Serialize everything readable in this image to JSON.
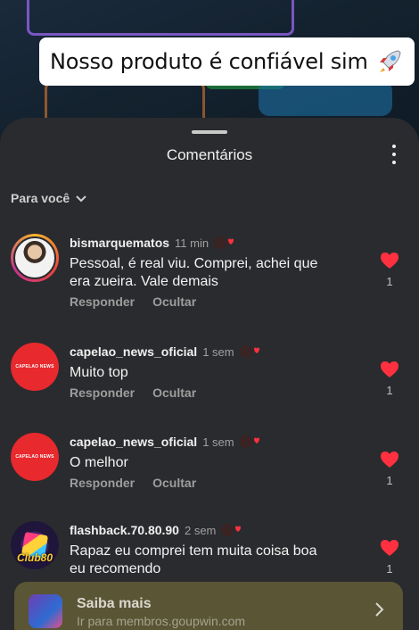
{
  "video": {
    "caption": "Nosso produto é confiável sim",
    "caption_emoji": "rocket-icon"
  },
  "sheet": {
    "title": "Comentários",
    "filter_label": "Para você",
    "menu_icon": "more-vertical-icon"
  },
  "comments": [
    {
      "user": "bismarquematos",
      "time": "11 min",
      "text_line1": "Pessoal, é real viu. Comprei, achei que",
      "text_line2": "era zueira. Vale demais",
      "reply": "Responder",
      "hide": "Ocultar",
      "likes": "1",
      "liked": true
    },
    {
      "user": "capelao_news_oficial",
      "time": "1 sem",
      "text_line1": "Muito top",
      "text_line2": "",
      "reply": "Responder",
      "hide": "Ocultar",
      "likes": "1",
      "liked": true,
      "avatar_text": "CAPELAO NEWS"
    },
    {
      "user": "capelao_news_oficial",
      "time": "1 sem",
      "text_line1": "O melhor",
      "text_line2": "",
      "reply": "Responder",
      "hide": "Ocultar",
      "likes": "1",
      "liked": true,
      "avatar_text": "CAPELAO NEWS"
    },
    {
      "user": "flashback.70.80.90",
      "time": "2 sem",
      "text_line1": "Rapaz eu comprei tem muita coisa boa",
      "text_line2": "eu recomendo",
      "reply": "Responder",
      "hide": "Ocultar",
      "likes": "1",
      "liked": true,
      "avatar_text": "Club80"
    }
  ],
  "promo": {
    "title": "Saiba mais",
    "subtitle": "Ir para membros.goupwin.com"
  },
  "colors": {
    "sheet_bg": "#2a2b2e",
    "like_red": "#ff3040",
    "promo_bg": "#5a5535"
  }
}
